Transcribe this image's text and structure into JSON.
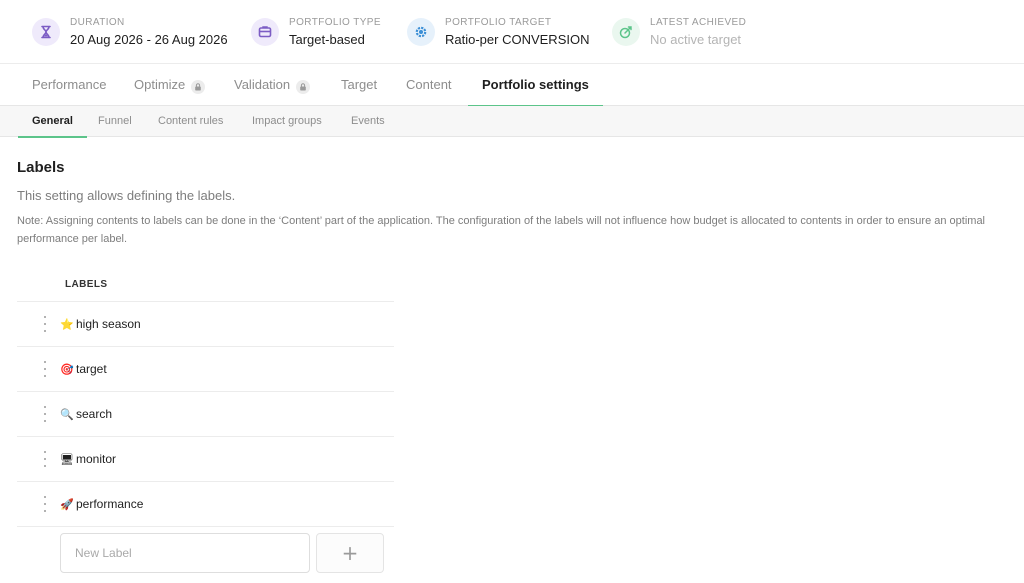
{
  "stats": [
    {
      "label": "DURATION",
      "value": "20 Aug 2026 - 26 Aug 2026",
      "icon": "hourglass-icon",
      "color": "#7c5cc4"
    },
    {
      "label": "PORTFOLIO TYPE",
      "value": "Target-based",
      "icon": "portfolio-icon",
      "color": "#7c5cc4"
    },
    {
      "label": "PORTFOLIO TARGET",
      "value": "Ratio-per CONVERSION",
      "icon": "gear-icon",
      "color": "#3b8fd6"
    },
    {
      "label": "LATEST ACHIEVED",
      "value": "No active target",
      "icon": "target-arrow-icon",
      "color": "#5cc48a"
    }
  ],
  "main_tabs": [
    {
      "label": "Performance"
    },
    {
      "label": "Optimize",
      "locked": true
    },
    {
      "label": "Validation",
      "locked": true
    },
    {
      "label": "Target"
    },
    {
      "label": "Content"
    },
    {
      "label": "Portfolio settings",
      "active": true
    }
  ],
  "sub_tabs": [
    {
      "label": "General",
      "active": true
    },
    {
      "label": "Funnel"
    },
    {
      "label": "Content rules"
    },
    {
      "label": "Impact groups"
    },
    {
      "label": "Events"
    }
  ],
  "section": {
    "title": "Labels",
    "description": "This setting allows defining the labels.",
    "note": "Note: Assigning contents to labels can be done in the ‘Content’ part of the application. The configuration of the labels will not influence how budget is allocated to contents in order to ensure an optimal performance per label."
  },
  "labels_table": {
    "header": "LABELS",
    "rows": [
      {
        "emoji": "⭐",
        "name": "high season"
      },
      {
        "emoji": "🎯",
        "name": "target"
      },
      {
        "emoji": "🔍",
        "name": "search"
      },
      {
        "emoji": "🖥",
        "name": "monitor"
      },
      {
        "emoji": "🚀",
        "name": "performance"
      }
    ]
  },
  "new_label": {
    "placeholder": "New Label",
    "value": "",
    "add_label": "+"
  },
  "colors": {
    "accent": "#5cc48a"
  }
}
